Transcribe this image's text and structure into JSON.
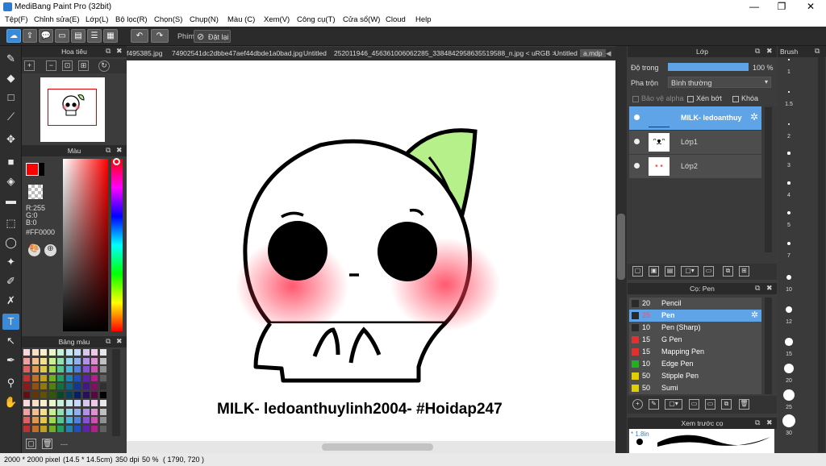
{
  "app": {
    "title": "MediBang Paint Pro (32bit)"
  },
  "window": {
    "minimize": "—",
    "maximize": "❐",
    "close": "✕"
  },
  "menu": [
    "Tệp(F)",
    "Chỉnh sửa(E)",
    "Lớp(L)",
    "Bộ lọc(R)",
    "Chọn(S)",
    "Chụp(N)",
    "Màu (C)",
    "Xem(V)",
    "Công cụ(T)",
    "Cửa sổ(W)",
    "Cloud",
    "Help"
  ],
  "toolbar": {
    "key_label": "Phím",
    "reset_label": "Đặt lại"
  },
  "tabs": [
    "f495385.jpg",
    "74902541dc2dbbe47aef44dbde1a0bad.jpg",
    "Untitled",
    "252011946_456361006062285_3384842958635519588_n.jpg < uRGB >",
    "Untitled",
    "a.mdp"
  ],
  "navigator": {
    "title": "Hoa tiêu"
  },
  "color": {
    "title": "Màu",
    "r": "R:255",
    "g": "G:0",
    "b": "B:0",
    "hex": "#FF0000",
    "primary": "#ff0000"
  },
  "palette": {
    "title": "Bảng màu",
    "footer": "---"
  },
  "layers": {
    "title": "Lớp",
    "opacity_label": "Độ trong",
    "opacity_value": "100 %",
    "blend_label": "Pha trộn",
    "blend_value": "Bình thường",
    "protect_alpha": "Bảo vệ alpha",
    "clip": "Xén bớt",
    "lock": "Khóa",
    "items": [
      {
        "name": "MILK- ledoanthuy",
        "selected": true
      },
      {
        "name": "Lớp1",
        "selected": false
      },
      {
        "name": "Lớp2",
        "selected": false
      }
    ]
  },
  "brush_panel": {
    "title": "Cọ: Pen",
    "items": [
      {
        "size": "20",
        "name": "Pencil",
        "color": "#2a2a2a"
      },
      {
        "size": "25",
        "name": "Pen",
        "color": "#2a2a2a",
        "selected": true
      },
      {
        "size": "10",
        "name": "Pen (Sharp)",
        "color": "#2a2a2a"
      },
      {
        "size": "15",
        "name": "G Pen",
        "color": "#e03030"
      },
      {
        "size": "15",
        "name": "Mapping Pen",
        "color": "#e03030"
      },
      {
        "size": "10",
        "name": "Edge Pen",
        "color": "#20b020"
      },
      {
        "size": "50",
        "name": "Stipple Pen",
        "color": "#e0d000"
      },
      {
        "size": "50",
        "name": "Sumi",
        "color": "#e0d000"
      }
    ]
  },
  "brush_preview": {
    "title": "Xem trước cọ",
    "size": "* 1.8in"
  },
  "brush_size": {
    "title": "Brush",
    "sizes": [
      "1",
      "1.5",
      "2",
      "3",
      "4",
      "5",
      "7",
      "10",
      "12",
      "15",
      "20",
      "25",
      "30"
    ]
  },
  "artwork": {
    "caption": "MILK- ledoanthuylinh2004- #Hoidap247"
  },
  "status": {
    "size": "2000 * 2000 pixel",
    "physical": "(14.5 * 14.5cm)",
    "dpi": "350 dpi",
    "zoom": "50 %",
    "coords": "( 1790, 720 )"
  }
}
